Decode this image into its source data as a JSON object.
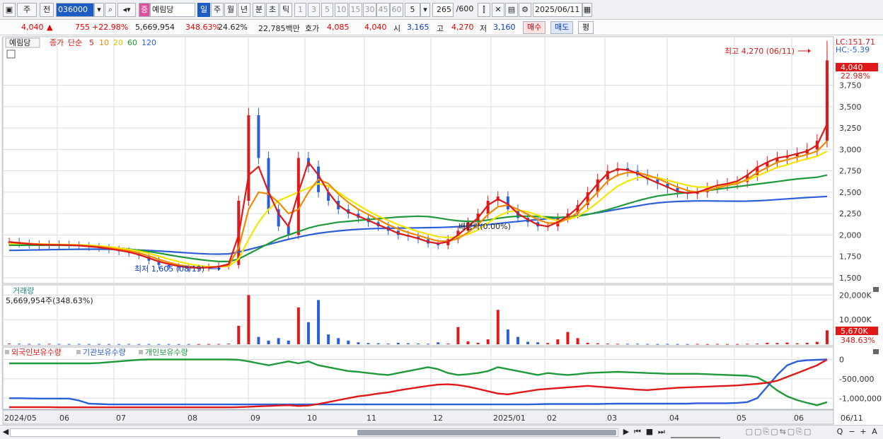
{
  "toolbar": {
    "market": "주",
    "mode": "전",
    "code": "036000",
    "stock_type": "증",
    "stock_name": "예림당",
    "periods": [
      "일",
      "주",
      "월",
      "년",
      "분",
      "초",
      "틱"
    ],
    "active_period": "일",
    "intervals": [
      "1",
      "3",
      "5",
      "10",
      "15",
      "30",
      "45",
      "60"
    ],
    "interval_value": "5",
    "count": "265",
    "count_max": "/600",
    "date": "2025/06/11"
  },
  "quote": {
    "price": "4,040",
    "arrow": "▲",
    "change": "755",
    "change_pct": "+22.98%",
    "volume": "5,669,954",
    "vol_ratio": "348.63%",
    "turnover": "24.62%",
    "amount": "22,785백만",
    "bid_label": "호가",
    "bid": "4,085",
    "ask": "4,040",
    "open_label": "시",
    "open": "3,165",
    "high_label": "고",
    "high": "4,270",
    "low_label": "저",
    "low": "3,160",
    "buy_label": "매수",
    "sell_label": "매도",
    "eval_label": "평"
  },
  "chart_data": {
    "type": "line",
    "title": "예림당",
    "price_panel": {
      "legend_price": "종가",
      "legend_ma_type": "단순",
      "ma_periods": [
        "5",
        "10",
        "20",
        "60",
        "120"
      ],
      "ma_colors": [
        "#e01818",
        "#f08a00",
        "#f5e600",
        "#1f9a3a",
        "#2b5fd8"
      ],
      "ylim": [
        1450,
        4300
      ],
      "yticks": [
        1500,
        1750,
        2000,
        2250,
        2500,
        2750,
        3000,
        3250,
        3500,
        3750
      ],
      "ytick_labels": [
        "1,500",
        "1,750",
        "2,000",
        "2,250",
        "2,500",
        "2,750",
        "3,000",
        "3,250",
        "3,500",
        "3,750"
      ],
      "x_labels": [
        "2024/05",
        "06",
        "07",
        "08",
        "09",
        "10",
        "11",
        "12",
        "2025/01",
        "02",
        "03",
        "04",
        "05",
        "06",
        "06/11"
      ],
      "lc_label": "LC:151.71",
      "hc_label": "HC:-5.39",
      "current_price_label": "4,040",
      "current_change_label": "22.98%",
      "max_annotation": "최고 4,270 (06/11)",
      "min_annotation": "최저 1,605 (08/19)",
      "dividend_annotation": "배당락(0.00%)",
      "close": [
        1920,
        1900,
        1890,
        1880,
        1890,
        1885,
        1880,
        1870,
        1860,
        1850,
        1830,
        1810,
        1790,
        1760,
        1700,
        1650,
        1630,
        1620,
        1610,
        1615,
        1625,
        1640,
        1650,
        2400,
        3400,
        2900,
        2300,
        2100,
        2000,
        2900,
        2800,
        2500,
        2400,
        2300,
        2250,
        2200,
        2150,
        2100,
        2050,
        2000,
        1980,
        1950,
        1900,
        1880,
        1950,
        2050,
        2150,
        2250,
        2400,
        2450,
        2300,
        2200,
        2150,
        2100,
        2100,
        2200,
        2250,
        2350,
        2500,
        2650,
        2750,
        2780,
        2750,
        2700,
        2650,
        2600,
        2550,
        2500,
        2480,
        2500,
        2550,
        2580,
        2600,
        2620,
        2700,
        2800,
        2850,
        2900,
        2920,
        2950,
        3000,
        3100,
        4040
      ],
      "ma5": [
        1920,
        1905,
        1895,
        1888,
        1885,
        1884,
        1881,
        1876,
        1866,
        1856,
        1840,
        1820,
        1800,
        1770,
        1730,
        1690,
        1660,
        1635,
        1620,
        1615,
        1620,
        1630,
        1660,
        2000,
        2700,
        2800,
        2500,
        2250,
        2100,
        2500,
        2850,
        2700,
        2500,
        2350,
        2270,
        2220,
        2170,
        2120,
        2070,
        2020,
        1990,
        1960,
        1920,
        1900,
        1920,
        2000,
        2100,
        2200,
        2350,
        2420,
        2360,
        2250,
        2180,
        2120,
        2100,
        2150,
        2220,
        2320,
        2460,
        2600,
        2720,
        2770,
        2760,
        2720,
        2660,
        2610,
        2560,
        2510,
        2490,
        2500,
        2540,
        2580,
        2600,
        2630,
        2700,
        2790,
        2850,
        2900,
        2920,
        2950,
        2980,
        3050,
        3300
      ],
      "ma10": [
        1915,
        1910,
        1900,
        1892,
        1888,
        1886,
        1884,
        1880,
        1872,
        1862,
        1850,
        1832,
        1815,
        1790,
        1755,
        1715,
        1680,
        1650,
        1632,
        1622,
        1620,
        1628,
        1645,
        1850,
        2300,
        2500,
        2480,
        2380,
        2250,
        2300,
        2500,
        2650,
        2600,
        2480,
        2380,
        2300,
        2240,
        2180,
        2120,
        2070,
        2030,
        1995,
        1960,
        1930,
        1925,
        1960,
        2030,
        2120,
        2240,
        2330,
        2350,
        2300,
        2240,
        2180,
        2140,
        2140,
        2190,
        2260,
        2380,
        2500,
        2630,
        2700,
        2730,
        2730,
        2700,
        2660,
        2610,
        2560,
        2520,
        2500,
        2520,
        2550,
        2580,
        2600,
        2650,
        2730,
        2790,
        2850,
        2880,
        2910,
        2940,
        2980,
        3100
      ],
      "ma20": [
        1900,
        1900,
        1898,
        1895,
        1892,
        1890,
        1888,
        1885,
        1880,
        1872,
        1862,
        1848,
        1832,
        1812,
        1785,
        1752,
        1718,
        1688,
        1662,
        1642,
        1630,
        1628,
        1635,
        1720,
        1950,
        2150,
        2300,
        2400,
        2450,
        2500,
        2550,
        2600,
        2570,
        2500,
        2420,
        2350,
        2280,
        2220,
        2170,
        2120,
        2080,
        2040,
        2010,
        1980,
        1970,
        1980,
        2010,
        2060,
        2140,
        2220,
        2270,
        2290,
        2270,
        2230,
        2190,
        2170,
        2180,
        2220,
        2290,
        2380,
        2480,
        2570,
        2630,
        2670,
        2680,
        2670,
        2640,
        2610,
        2580,
        2560,
        2560,
        2570,
        2590,
        2610,
        2640,
        2690,
        2740,
        2790,
        2820,
        2860,
        2890,
        2920,
        2980
      ],
      "ma60": [
        1880,
        1880,
        1880,
        1880,
        1880,
        1880,
        1878,
        1876,
        1872,
        1866,
        1858,
        1848,
        1836,
        1822,
        1806,
        1788,
        1768,
        1748,
        1730,
        1714,
        1700,
        1690,
        1690,
        1720,
        1780,
        1840,
        1900,
        1960,
        2000,
        2040,
        2080,
        2110,
        2130,
        2150,
        2160,
        2170,
        2180,
        2190,
        2200,
        2210,
        2215,
        2220,
        2215,
        2200,
        2180,
        2165,
        2160,
        2160,
        2175,
        2195,
        2210,
        2220,
        2220,
        2215,
        2210,
        2205,
        2210,
        2220,
        2240,
        2265,
        2295,
        2330,
        2365,
        2400,
        2430,
        2455,
        2470,
        2485,
        2495,
        2505,
        2520,
        2535,
        2550,
        2565,
        2580,
        2595,
        2610,
        2625,
        2640,
        2655,
        2665,
        2675,
        2700
      ],
      "ma120": [
        1820,
        1822,
        1824,
        1826,
        1828,
        1830,
        1832,
        1833,
        1834,
        1834,
        1833,
        1831,
        1828,
        1824,
        1819,
        1813,
        1806,
        1798,
        1790,
        1783,
        1778,
        1776,
        1780,
        1800,
        1830,
        1860,
        1890,
        1920,
        1950,
        1975,
        2000,
        2020,
        2035,
        2048,
        2058,
        2066,
        2072,
        2076,
        2078,
        2080,
        2082,
        2084,
        2086,
        2088,
        2092,
        2098,
        2104,
        2112,
        2122,
        2134,
        2146,
        2158,
        2170,
        2180,
        2190,
        2200,
        2212,
        2226,
        2242,
        2260,
        2280,
        2300,
        2320,
        2340,
        2360,
        2375,
        2385,
        2392,
        2396,
        2398,
        2398,
        2397,
        2396,
        2395,
        2396,
        2400,
        2406,
        2414,
        2422,
        2430,
        2438,
        2444,
        2450
      ]
    },
    "volume_panel": {
      "title": "거래량",
      "current_label": "5,669,954주(348.63%)",
      "ylim": [
        0,
        23000
      ],
      "ytick_labels": [
        "20,000K",
        "10,000K"
      ],
      "yticks": [
        20000,
        10000
      ],
      "current_value_label": "5,670K",
      "current_pct_label": "348.63%",
      "values_k": [
        300,
        200,
        150,
        150,
        200,
        150,
        120,
        150,
        120,
        120,
        100,
        100,
        150,
        100,
        120,
        100,
        100,
        80,
        100,
        80,
        100,
        150,
        300,
        7500,
        20000,
        3000,
        1500,
        2500,
        1500,
        15000,
        9000,
        18000,
        4000,
        2500,
        1500,
        800,
        500,
        400,
        300,
        600,
        400,
        300,
        200,
        800,
        300,
        7000,
        1200,
        600,
        2000,
        14000,
        6000,
        3000,
        1000,
        800,
        500,
        2000,
        5000,
        2500,
        600,
        400,
        300,
        200,
        200,
        200,
        150,
        100,
        150,
        120,
        100,
        150,
        100,
        150,
        100,
        120,
        200,
        300,
        600,
        500,
        700,
        400,
        600,
        1000,
        5670
      ],
      "colors": [
        "#2b5fd8",
        "#e01818"
      ]
    },
    "holding_panel": {
      "legend": [
        "외국인보유수량",
        "기관보유수량",
        "개인보유수량"
      ],
      "colors": [
        "#e01818",
        "#2b5fd8",
        "#1f9a3a"
      ],
      "ylim": [
        -1250000,
        100000
      ],
      "yticks": [
        0,
        -500000,
        -1000000
      ],
      "ytick_labels": [
        "0",
        "-500,000",
        "-1,000,000"
      ],
      "foreign": [
        -1230000,
        -1230000,
        -1230000,
        -1230000,
        -1230000,
        -1235000,
        -1235000,
        -1235000,
        -1235000,
        -1235000,
        -1235000,
        -1235000,
        -1235000,
        -1235000,
        -1235000,
        -1235000,
        -1235000,
        -1235000,
        -1235000,
        -1235000,
        -1235000,
        -1235000,
        -1235000,
        -1230000,
        -1220000,
        -1210000,
        -1200000,
        -1190000,
        -1180000,
        -1200000,
        -1190000,
        -1150000,
        -1100000,
        -1050000,
        -1000000,
        -950000,
        -920000,
        -880000,
        -850000,
        -800000,
        -760000,
        -720000,
        -680000,
        -650000,
        -640000,
        -660000,
        -700000,
        -760000,
        -820000,
        -880000,
        -900000,
        -860000,
        -820000,
        -780000,
        -760000,
        -740000,
        -720000,
        -700000,
        -680000,
        -700000,
        -720000,
        -740000,
        -760000,
        -780000,
        -790000,
        -770000,
        -750000,
        -730000,
        -720000,
        -710000,
        -700000,
        -690000,
        -680000,
        -670000,
        -650000,
        -630000,
        -600000,
        -550000,
        -450000,
        -350000,
        -250000,
        -150000,
        0
      ],
      "institution": [
        -1000000,
        -1000000,
        -1005000,
        -1010000,
        -1010000,
        -1010000,
        -1010000,
        -1060000,
        -1140000,
        -1150000,
        -1160000,
        -1160000,
        -1160000,
        -1160000,
        -1160000,
        -1160000,
        -1160000,
        -1160000,
        -1160000,
        -1160000,
        -1160000,
        -1160000,
        -1160000,
        -1160000,
        -1160000,
        -1160000,
        -1160000,
        -1160000,
        -1160000,
        -1160000,
        -1160000,
        -1160000,
        -1160000,
        -1160000,
        -1160000,
        -1160000,
        -1160000,
        -1160000,
        -1160000,
        -1160000,
        -1160000,
        -1160000,
        -1160000,
        -1160000,
        -1160000,
        -1160000,
        -1160000,
        -1160000,
        -1160000,
        -1160000,
        -1160000,
        -1160000,
        -1160000,
        -1155000,
        -1150000,
        -1150000,
        -1150000,
        -1150000,
        -1150000,
        -1150000,
        -1145000,
        -1140000,
        -1140000,
        -1140000,
        -1140000,
        -1140000,
        -1140000,
        -1140000,
        -1140000,
        -1130000,
        -1130000,
        -1130000,
        -1130000,
        -1120000,
        -1100000,
        -1000000,
        -700000,
        -400000,
        -150000,
        -50000,
        -20000,
        -10000,
        0
      ],
      "individual": [
        -100000,
        -100000,
        -100000,
        -100000,
        -100000,
        -100000,
        -100000,
        -100000,
        -100000,
        -90000,
        -70000,
        -50000,
        -30000,
        -10000,
        0,
        0,
        0,
        0,
        0,
        0,
        0,
        0,
        0,
        -10000,
        -50000,
        -100000,
        -150000,
        -100000,
        -50000,
        -100000,
        -50000,
        -150000,
        -200000,
        -250000,
        -300000,
        -320000,
        -350000,
        -380000,
        -400000,
        -350000,
        -300000,
        -250000,
        -200000,
        -250000,
        -350000,
        -400000,
        -380000,
        -350000,
        -300000,
        -200000,
        -250000,
        -300000,
        -350000,
        -400000,
        -350000,
        -380000,
        -400000,
        -380000,
        -350000,
        -340000,
        -330000,
        -320000,
        -330000,
        -340000,
        -350000,
        -360000,
        -370000,
        -370000,
        -370000,
        -370000,
        -380000,
        -390000,
        -400000,
        -410000,
        -420000,
        -460000,
        -600000,
        -800000,
        -950000,
        -1050000,
        -1120000,
        -1180000,
        -1100000
      ]
    }
  },
  "bottombar": {
    "controls": [
      "◀",
      "▶",
      "⏮",
      "■",
      "⏭",
      "−",
      "+",
      "A",
      "Q"
    ]
  }
}
